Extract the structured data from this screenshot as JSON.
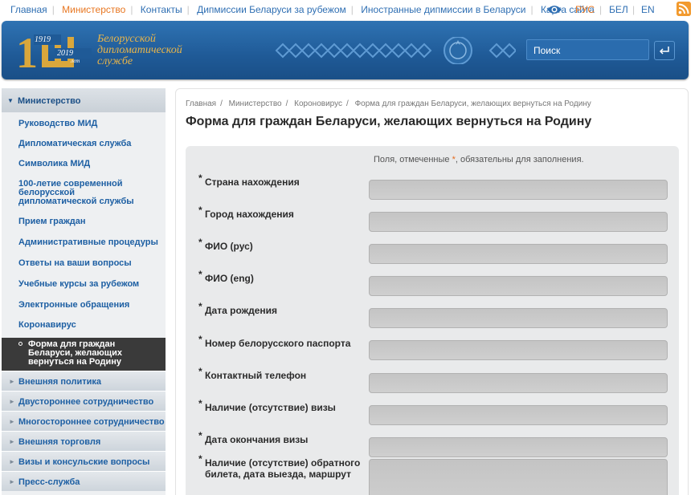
{
  "topnav": {
    "links": [
      "Главная",
      "Министерство",
      "Контакты",
      "Дипмиссии Беларуси за рубежом",
      "Иностранные дипмиссии в Беларуси",
      "Карта сайта"
    ],
    "active_index": 1,
    "langs": [
      "РУС",
      "БЕЛ",
      "EN"
    ],
    "active_lang": "РУС",
    "icons": {
      "accessibility": "eye-icon",
      "feed": "rss-icon"
    }
  },
  "banner": {
    "logo_year_start": "1919",
    "logo_year_end": "2019",
    "logo_years_word": "лет",
    "logo_line1": "Белорусской",
    "logo_line2": "дипломатической",
    "logo_line3": "службе",
    "search_placeholder": "Поиск",
    "search_button_icon": "enter-icon"
  },
  "sidebar": {
    "head": "Министерство",
    "items": [
      "Руководство МИД",
      "Дипломатическая служба",
      "Символика МИД",
      "100-летие современной белорусской дипломатической службы",
      "Прием граждан",
      "Административные процедуры",
      "Ответы на ваши вопросы",
      "Учебные курсы за рубежом",
      "Электронные обращения",
      "Коронавирус"
    ],
    "active_item": "Форма для граждан Беларуси, желающих вернуться на Родину",
    "sections": [
      "Внешняя политика",
      "Двустороннее сотрудничество",
      "Многостороннее сотрудничество",
      "Внешняя торговля",
      "Визы и консульские вопросы",
      "Пресс-служба"
    ]
  },
  "main": {
    "breadcrumb": [
      "Главная",
      "Министерство",
      "Короновирус",
      "Форма для граждан Беларуси, желающих вернуться на Родину"
    ],
    "title": "Форма для граждан Беларуси, желающих вернуться на Родину",
    "required_note_pre": "Поля, отмеченные",
    "required_star": "*",
    "required_note_post": ", обязательны для заполнения.",
    "fields": [
      "Страна нахождения",
      "Город нахождения",
      "ФИО (рус)",
      "ФИО (eng)",
      "Дата рождения",
      "Номер белорусского паспорта",
      "Контактный телефон",
      "Наличие (отсутствие) визы",
      "Дата окончания визы",
      "Наличие (отсутствие) обратного билета, дата выезда, маршрут"
    ]
  }
}
